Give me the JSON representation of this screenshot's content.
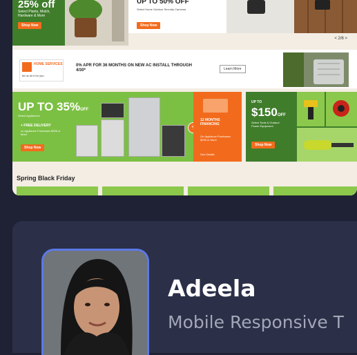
{
  "promos": {
    "card1": {
      "headline": "25% off",
      "sub": "Select Plants, Mulch, Hardware & More",
      "button": "Shop Now"
    },
    "card2": {
      "headline": "UP TO 50% OFF",
      "sub": "Select Home Outdoor Security Cameras",
      "button": "Shop Now"
    },
    "pager": "< 2/6 >"
  },
  "install_banner": {
    "logo_line1": "HOME SERVICES",
    "logo_line2": "let us do it for you",
    "headline": "0% APR FOR 36 MONTHS ON NEW AC INSTALL THROUGH 4/30*",
    "learn_more": "Learn More"
  },
  "appliance_banner": {
    "percent": "UP TO 35%",
    "percent_suffix": "OFF",
    "sub": "Select Appliances",
    "free_delivery": "+ FREE DELIVERY",
    "free_sub": "on Appliance Purchases $396 or More",
    "button": "Shop Now",
    "financing_title": "12 MONTHS FINANCING",
    "financing_sub": "On Appliance Purchases $299 or More",
    "financing_link": "See Details"
  },
  "tools_banner": {
    "up_to": "UP TO",
    "amount": "$150",
    "amount_suffix": "OFF",
    "sub": "Select Tools & Outdoor Power Equipment",
    "button": "Shop Now"
  },
  "section_title": "Spring Black Friday",
  "profile": {
    "name": "Adeela",
    "role": "Mobile Responsive T"
  },
  "colors": {
    "page_bg": "#1f2235",
    "card_bg": "#2b2f47",
    "avatar_border": "#5b79e8",
    "brand_orange": "#f26b1d",
    "brand_green": "#3f7d2b",
    "light_green": "#7cc043"
  }
}
